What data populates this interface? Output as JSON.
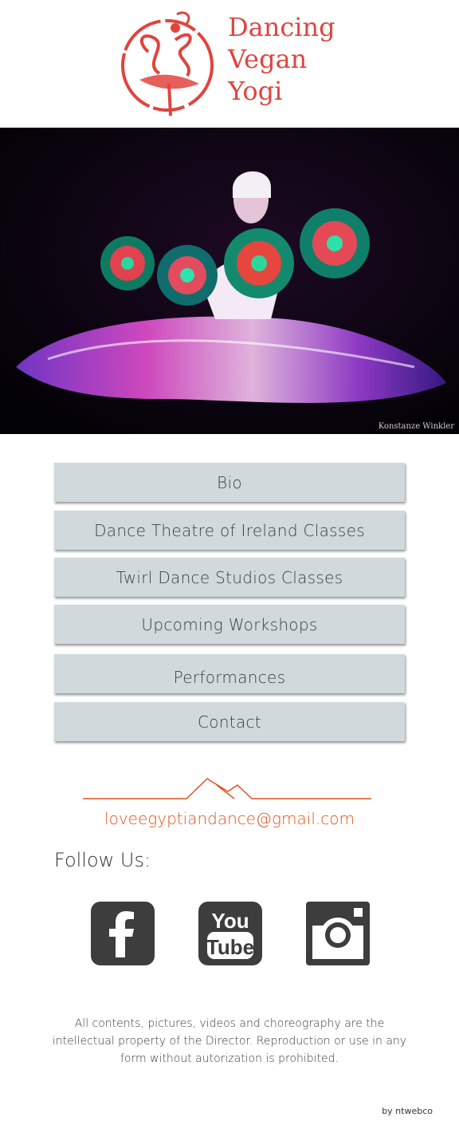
{
  "brand": {
    "line1": "Dancing",
    "line2": "Vegan",
    "line3": "Yogi",
    "color": "#e0443e"
  },
  "hero": {
    "credit": "Konstanze Winkler",
    "icon": "whirling-dancer-photo"
  },
  "menu": [
    {
      "label": "Bio"
    },
    {
      "label": "Dance Theatre of Ireland Classes"
    },
    {
      "label": "Twirl Dance Studios Classes"
    },
    {
      "label": "Upcoming Workshops"
    },
    {
      "label": "Performances"
    },
    {
      "label": "Contact"
    }
  ],
  "contact": {
    "email": "loveegyptiandance@gmail.com",
    "accent": "#e2541e",
    "divider_icon": "mountain-divider-icon"
  },
  "social": {
    "heading": "Follow Us:",
    "icons": [
      "facebook-icon",
      "youtube-icon",
      "instagram-icon"
    ]
  },
  "footer": {
    "legal": "All contents, pictures, videos and choreography are the intellectual property of the Director. Reproduction or use in any form without autorization is prohibited.",
    "byline": "by ntwebco"
  }
}
